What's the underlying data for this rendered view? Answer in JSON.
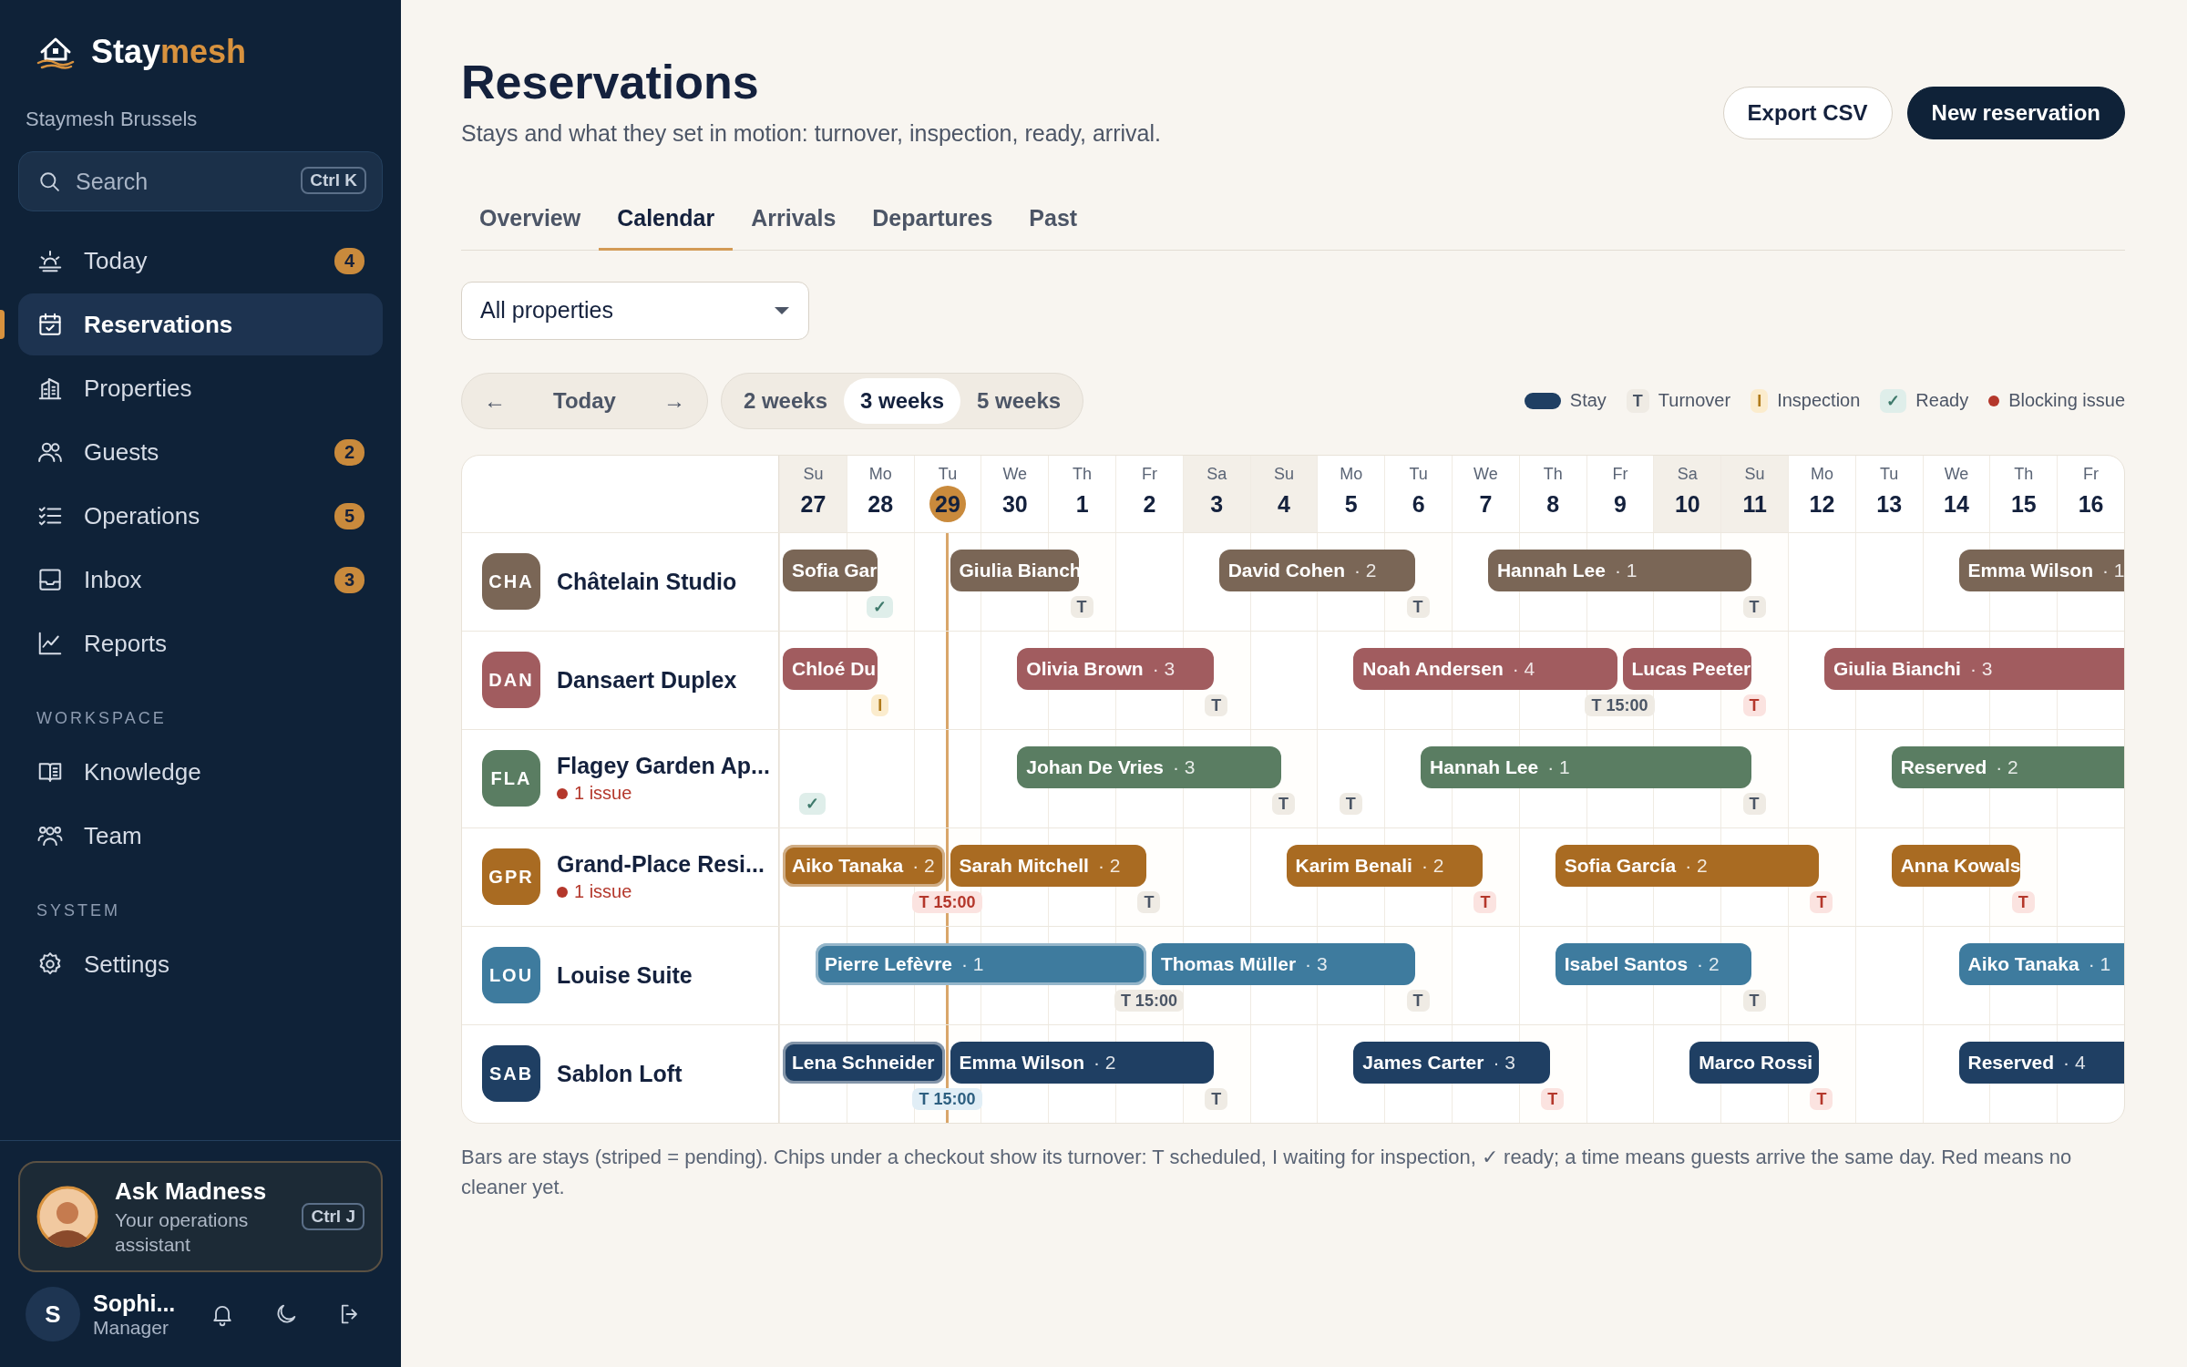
{
  "sidebar": {
    "brand_parts": [
      "Stay",
      "mesh"
    ],
    "workspace": "Staymesh Brussels",
    "search": {
      "placeholder": "Search",
      "shortcut": "Ctrl K"
    },
    "groups": [
      {
        "items": [
          {
            "label": "Today",
            "badge": "4",
            "selected": false
          },
          {
            "label": "Reservations",
            "selected": true
          },
          {
            "label": "Properties",
            "selected": false
          },
          {
            "label": "Guests",
            "badge": "2",
            "selected": false
          },
          {
            "label": "Operations",
            "badge": "5",
            "selected": false
          },
          {
            "label": "Inbox",
            "badge": "3",
            "selected": false
          },
          {
            "label": "Reports",
            "selected": false
          }
        ]
      },
      {
        "heading": "WORKSPACE",
        "items": [
          {
            "label": "Knowledge",
            "selected": false
          },
          {
            "label": "Team",
            "selected": false
          }
        ]
      },
      {
        "heading": "SYSTEM",
        "items": [
          {
            "label": "Settings",
            "selected": false
          }
        ]
      }
    ],
    "assistant": {
      "title": "Ask Madness",
      "subtitle": "Your operations assistant",
      "shortcut": "Ctrl J"
    },
    "user": {
      "initial": "S",
      "name": "Sophi...",
      "role": "Manager"
    }
  },
  "page": {
    "title": "Reservations",
    "subtitle": "Stays and what they set in motion: turnover, inspection, ready, arrival.",
    "buttons": [
      {
        "label": "Export CSV",
        "kind": "secondary"
      },
      {
        "label": "New reservation",
        "kind": "primary"
      }
    ],
    "tabs": [
      {
        "label": "Overview",
        "selected": false
      },
      {
        "label": "Calendar",
        "selected": true
      },
      {
        "label": "Arrivals",
        "selected": false
      },
      {
        "label": "Departures",
        "selected": false
      },
      {
        "label": "Past",
        "selected": false
      }
    ],
    "property_filter": "All properties",
    "nav": {
      "prev": "←",
      "today": "Today",
      "next": "→"
    },
    "ranges": [
      {
        "label": "2 weeks",
        "selected": false
      },
      {
        "label": "3 weeks",
        "selected": true
      },
      {
        "label": "5 weeks",
        "selected": false
      }
    ],
    "legend": [
      {
        "kind": "stay",
        "label": "Stay"
      },
      {
        "kind": "turnover",
        "mark": "T",
        "label": "Turnover"
      },
      {
        "kind": "inspection",
        "mark": "I",
        "label": "Inspection"
      },
      {
        "kind": "ready",
        "mark": "✓",
        "label": "Ready"
      },
      {
        "kind": "issue",
        "label": "Blocking issue"
      }
    ],
    "note": "Bars are stays (striped = pending). Chips under a checkout show its turnover: T scheduled, I waiting for inspection, ✓ ready; a time means guests arrive the same day. Red means no cleaner yet."
  },
  "calendar": {
    "days": [
      {
        "weekday": "Su",
        "date": "27",
        "weekend": true,
        "today": false
      },
      {
        "weekday": "Mo",
        "date": "28",
        "weekend": false,
        "today": false
      },
      {
        "weekday": "Tu",
        "date": "29",
        "weekend": false,
        "today": true
      },
      {
        "weekday": "We",
        "date": "30",
        "weekend": false,
        "today": false
      },
      {
        "weekday": "Th",
        "date": "1",
        "weekend": false,
        "today": false
      },
      {
        "weekday": "Fr",
        "date": "2",
        "weekend": false,
        "today": false
      },
      {
        "weekday": "Sa",
        "date": "3",
        "weekend": true,
        "today": false
      },
      {
        "weekday": "Su",
        "date": "4",
        "weekend": true,
        "today": false
      },
      {
        "weekday": "Mo",
        "date": "5",
        "weekend": false,
        "today": false
      },
      {
        "weekday": "Tu",
        "date": "6",
        "weekend": false,
        "today": false
      },
      {
        "weekday": "We",
        "date": "7",
        "weekend": false,
        "today": false
      },
      {
        "weekday": "Th",
        "date": "8",
        "weekend": false,
        "today": false
      },
      {
        "weekday": "Fr",
        "date": "9",
        "weekend": false,
        "today": false
      },
      {
        "weekday": "Sa",
        "date": "10",
        "weekend": true,
        "today": false
      },
      {
        "weekday": "Su",
        "date": "11",
        "weekend": true,
        "today": false
      },
      {
        "weekday": "Mo",
        "date": "12",
        "weekend": false,
        "today": false
      },
      {
        "weekday": "Tu",
        "date": "13",
        "weekend": false,
        "today": false
      },
      {
        "weekday": "We",
        "date": "14",
        "weekend": false,
        "today": false
      },
      {
        "weekday": "Th",
        "date": "15",
        "weekend": false,
        "today": false
      },
      {
        "weekday": "Fr",
        "date": "16",
        "weekend": false,
        "today": false
      }
    ],
    "properties": [
      {
        "code": "CHA",
        "name": "Châtelain Studio",
        "color": "#7a6656",
        "days": [
          {
            "departure": false,
            "arrival": {
              "guest": "Sofia Gar",
              "starts_before": true,
              "in_house": false
            }
          },
          {
            "departure": true,
            "chip": {
              "text": "✓",
              "kind": "ready"
            }
          },
          {
            "departure": false,
            "arrival": {
              "guest": "Giulia Bianch",
              "starts_before": false,
              "in_house": false
            }
          },
          {
            "departure": false
          },
          {
            "departure": true,
            "chip": {
              "text": "T",
              "kind": "turnover"
            }
          },
          {
            "departure": false
          },
          {
            "departure": false,
            "arrival": {
              "guest": "David Cohen",
              "guests": "· 2",
              "starts_before": false,
              "in_house": false
            }
          },
          {
            "departure": false
          },
          {
            "departure": false
          },
          {
            "departure": true,
            "chip": {
              "text": "T",
              "kind": "turnover"
            }
          },
          {
            "departure": false,
            "arrival": {
              "guest": "Hannah Lee",
              "guests": "· 1",
              "starts_before": false,
              "in_house": false
            }
          },
          {
            "departure": false
          },
          {
            "departure": false
          },
          {
            "departure": false
          },
          {
            "departure": true,
            "chip": {
              "text": "T",
              "kind": "turnover"
            }
          },
          {
            "departure": false
          },
          {
            "departure": false
          },
          {
            "departure": false,
            "arrival": {
              "guest": "Emma Wilson",
              "guests": "· 1",
              "starts_before": false,
              "in_house": false
            }
          },
          {
            "departure": false
          },
          {
            "departure": false
          }
        ]
      },
      {
        "code": "DAN",
        "name": "Dansaert Duplex",
        "color": "#a15c5f",
        "days": [
          {
            "departure": false,
            "arrival": {
              "guest": "Chloé Du",
              "starts_before": true,
              "in_house": false
            }
          },
          {
            "departure": true,
            "chip": {
              "text": "I",
              "kind": "inspection"
            }
          },
          {
            "departure": false
          },
          {
            "departure": false,
            "arrival": {
              "guest": "Olivia Brown",
              "guests": "· 3",
              "starts_before": false,
              "in_house": false
            }
          },
          {
            "departure": false
          },
          {
            "departure": false
          },
          {
            "departure": true,
            "chip": {
              "text": "T",
              "kind": "turnover"
            }
          },
          {
            "departure": false
          },
          {
            "departure": false,
            "arrival": {
              "guest": "Noah Andersen",
              "guests": "· 4",
              "starts_before": false,
              "in_house": false
            }
          },
          {
            "departure": false
          },
          {
            "departure": false
          },
          {
            "departure": false
          },
          {
            "departure": true,
            "chip": {
              "text": "T 15:00",
              "kind": "turnover"
            },
            "arrival": {
              "guest": "Lucas Peeter",
              "starts_before": false,
              "in_house": false
            }
          },
          {
            "departure": false
          },
          {
            "departure": true,
            "chip": {
              "text": "T",
              "kind": "unstaffed"
            }
          },
          {
            "departure": false,
            "arrival": {
              "guest": "Giulia Bianchi",
              "guests": "· 3",
              "starts_before": false,
              "in_house": false
            }
          },
          {
            "departure": false
          },
          {
            "departure": false
          },
          {
            "departure": false
          },
          {
            "departure": false
          }
        ]
      },
      {
        "code": "FLA",
        "name": "Flagey Garden Ap...",
        "issue": "1 issue",
        "color": "#5a7d62",
        "days": [
          {
            "departure": false,
            "chip": {
              "text": "✓",
              "kind": "ready"
            }
          },
          {
            "departure": false
          },
          {
            "departure": false
          },
          {
            "departure": false,
            "arrival": {
              "guest": "Johan De Vries",
              "guests": "· 3",
              "starts_before": false,
              "in_house": false
            }
          },
          {
            "departure": false
          },
          {
            "departure": false
          },
          {
            "departure": false
          },
          {
            "departure": true,
            "chip": {
              "text": "T",
              "kind": "turnover"
            }
          },
          {
            "departure": false,
            "chip": {
              "text": "T",
              "kind": "turnover"
            }
          },
          {
            "departure": false,
            "arrival": {
              "guest": "Hannah Lee",
              "guests": "· 1",
              "starts_before": false,
              "in_house": false
            }
          },
          {
            "departure": false
          },
          {
            "departure": false
          },
          {
            "departure": false
          },
          {
            "departure": false
          },
          {
            "departure": true,
            "chip": {
              "text": "T",
              "kind": "turnover"
            }
          },
          {
            "departure": false
          },
          {
            "departure": false,
            "arrival": {
              "guest": "Reserved",
              "guests": "· 2",
              "starts_before": false,
              "in_house": false
            }
          },
          {
            "departure": false
          },
          {
            "departure": false
          },
          {
            "departure": false
          }
        ]
      },
      {
        "code": "GPR",
        "name": "Grand-Place Resi...",
        "issue": "1 issue",
        "color": "#a96b22",
        "days": [
          {
            "departure": false,
            "arrival": {
              "guest": "Aiko Tanaka",
              "guests": "· 2",
              "starts_before": true,
              "in_house": true
            }
          },
          {
            "departure": false
          },
          {
            "departure": true,
            "chip": {
              "text": "T 15:00",
              "kind": "unstaffed"
            },
            "arrival": {
              "guest": "Sarah Mitchell",
              "guests": "· 2",
              "starts_before": false,
              "in_house": false
            }
          },
          {
            "departure": false
          },
          {
            "departure": false
          },
          {
            "departure": true,
            "chip": {
              "text": "T",
              "kind": "turnover"
            }
          },
          {
            "departure": false
          },
          {
            "departure": false,
            "arrival": {
              "guest": "Karim Benali",
              "guests": "· 2",
              "starts_before": false,
              "in_house": false
            }
          },
          {
            "departure": false
          },
          {
            "departure": false
          },
          {
            "departure": true,
            "chip": {
              "text": "T",
              "kind": "unstaffed"
            }
          },
          {
            "departure": false,
            "arrival": {
              "guest": "Sofia García",
              "guests": "· 2",
              "starts_before": false,
              "in_house": false
            }
          },
          {
            "departure": false
          },
          {
            "departure": false
          },
          {
            "departure": false
          },
          {
            "departure": true,
            "chip": {
              "text": "T",
              "kind": "unstaffed"
            }
          },
          {
            "departure": false,
            "arrival": {
              "guest": "Anna Kowals",
              "starts_before": false,
              "in_house": false
            }
          },
          {
            "departure": false
          },
          {
            "departure": true,
            "chip": {
              "text": "T",
              "kind": "unstaffed"
            }
          },
          {
            "departure": false
          }
        ]
      },
      {
        "code": "LOU",
        "name": "Louise Suite",
        "color": "#3e7b9e",
        "days": [
          {
            "departure": false,
            "arrival": {
              "guest": "Pierre Lefèvre",
              "guests": "· 1",
              "starts_before": false,
              "in_house": true
            }
          },
          {
            "departure": false
          },
          {
            "departure": false
          },
          {
            "departure": false
          },
          {
            "departure": false
          },
          {
            "departure": true,
            "chip": {
              "text": "T 15:00",
              "kind": "turnover"
            },
            "arrival": {
              "guest": "Thomas Müller",
              "guests": "· 3",
              "starts_before": false,
              "in_house": false
            }
          },
          {
            "departure": false
          },
          {
            "departure": false
          },
          {
            "departure": false
          },
          {
            "departure": true,
            "chip": {
              "text": "T",
              "kind": "turnover"
            }
          },
          {
            "departure": false
          },
          {
            "departure": false,
            "arrival": {
              "guest": "Isabel Santos",
              "guests": "· 2",
              "starts_before": false,
              "in_house": false
            }
          },
          {
            "departure": false
          },
          {
            "departure": false
          },
          {
            "departure": true,
            "chip": {
              "text": "T",
              "kind": "turnover"
            }
          },
          {
            "departure": false
          },
          {
            "departure": false
          },
          {
            "departure": false,
            "arrival": {
              "guest": "Aiko Tanaka",
              "guests": "· 1",
              "starts_before": false,
              "in_house": false
            }
          },
          {
            "departure": false
          },
          {
            "departure": false
          }
        ]
      },
      {
        "code": "SAB",
        "name": "Sablon Loft",
        "color": "#1f3f63",
        "days": [
          {
            "departure": false,
            "arrival": {
              "guest": "Lena Schneider",
              "starts_before": true,
              "in_house": true
            }
          },
          {
            "departure": false
          },
          {
            "departure": true,
            "chip": {
              "text": "T 15:00",
              "kind": "today"
            },
            "arrival": {
              "guest": "Emma Wilson",
              "guests": "· 2",
              "starts_before": false,
              "in_house": false
            }
          },
          {
            "departure": false
          },
          {
            "departure": false
          },
          {
            "departure": false
          },
          {
            "departure": true,
            "chip": {
              "text": "T",
              "kind": "turnover"
            }
          },
          {
            "departure": false
          },
          {
            "departure": false,
            "arrival": {
              "guest": "James Carter",
              "guests": "· 3",
              "starts_before": false,
              "in_house": false
            }
          },
          {
            "departure": false
          },
          {
            "departure": false
          },
          {
            "departure": true,
            "chip": {
              "text": "T",
              "kind": "unstaffed"
            }
          },
          {
            "departure": false
          },
          {
            "departure": false,
            "arrival": {
              "guest": "Marco Rossi",
              "starts_before": false,
              "in_house": false
            }
          },
          {
            "departure": false
          },
          {
            "departure": true,
            "chip": {
              "text": "T",
              "kind": "unstaffed"
            }
          },
          {
            "departure": false
          },
          {
            "departure": false,
            "arrival": {
              "guest": "Reserved",
              "guests": "· 4",
              "starts_before": false,
              "in_house": false
            }
          },
          {
            "departure": false
          },
          {
            "departure": false
          }
        ]
      }
    ]
  }
}
